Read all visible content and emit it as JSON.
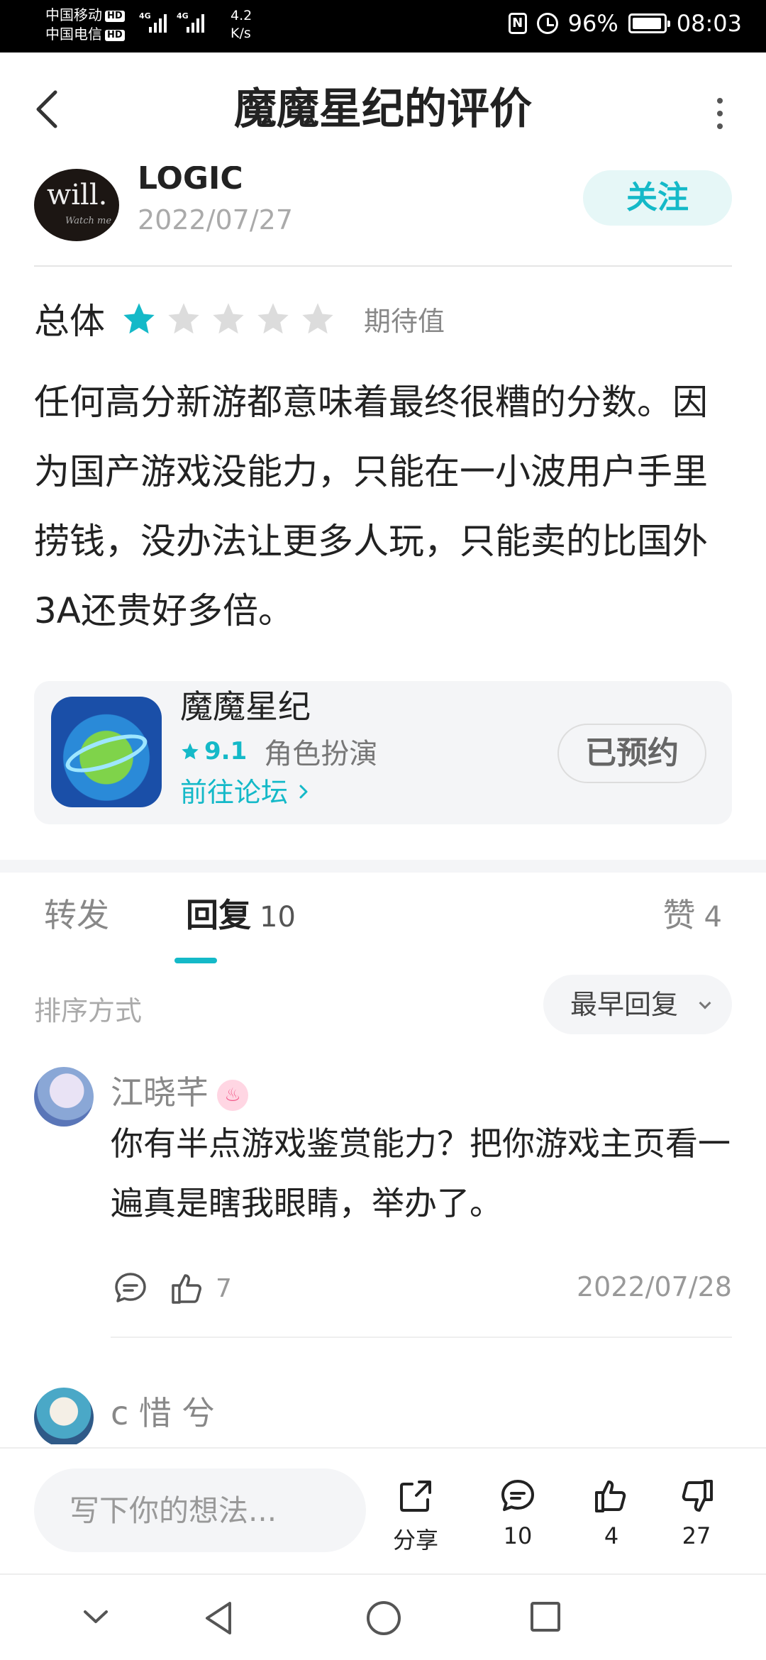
{
  "status_bar": {
    "carrier1": "中国移动",
    "carrier2": "中国电信",
    "hd": "HD",
    "net1": "4G",
    "net2": "4G",
    "speed_value": "4.2",
    "speed_unit": "K/s",
    "nfc": "N",
    "battery": "96%",
    "battery_level": 0.96,
    "time": "08:03"
  },
  "header": {
    "title": "魔魔星纪的评价"
  },
  "author": {
    "name": "LOGIC",
    "date": "2022/07/27",
    "avatar_text": "will.",
    "avatar_subtext": "Watch me",
    "follow_label": "关注"
  },
  "rating": {
    "label": "总体",
    "stars": 1,
    "max_stars": 5,
    "hint": "期待值"
  },
  "review": {
    "text": "任何高分新游都意味着最终很糟的分数。因为国产游戏没能力，只能在一小波用户手里捞钱，没办法让更多人玩，只能卖的比国外3A还贵好多倍。"
  },
  "game": {
    "name": "魔魔星纪",
    "score": "9.1",
    "genre": "角色扮演",
    "forum_link": "前往论坛",
    "reserved_label": "已预约"
  },
  "tabs": {
    "forward": "转发",
    "reply": "回复",
    "reply_count": "10",
    "likes": "赞",
    "likes_count": "4"
  },
  "sort": {
    "label": "排序方式",
    "selected": "最早回复"
  },
  "comments": [
    {
      "name": "江晓芊",
      "text": "你有半点游戏鉴赏能力？把你游戏主页看一遍真是瞎我眼睛，举办了。",
      "like_count": "7",
      "date": "2022/07/28"
    },
    {
      "name": "c 惜 兮"
    }
  ],
  "bottom_bar": {
    "input_placeholder": "写下你的想法...",
    "share_label": "分享",
    "comment_count": "10",
    "like_count": "4",
    "dislike_count": "27"
  },
  "colors": {
    "accent": "#14b9c8",
    "follow_bg": "#e6f7f7",
    "card_bg": "#f4f5f7",
    "text": "#222222",
    "muted": "#888888",
    "star_empty": "#dcdcdc"
  }
}
